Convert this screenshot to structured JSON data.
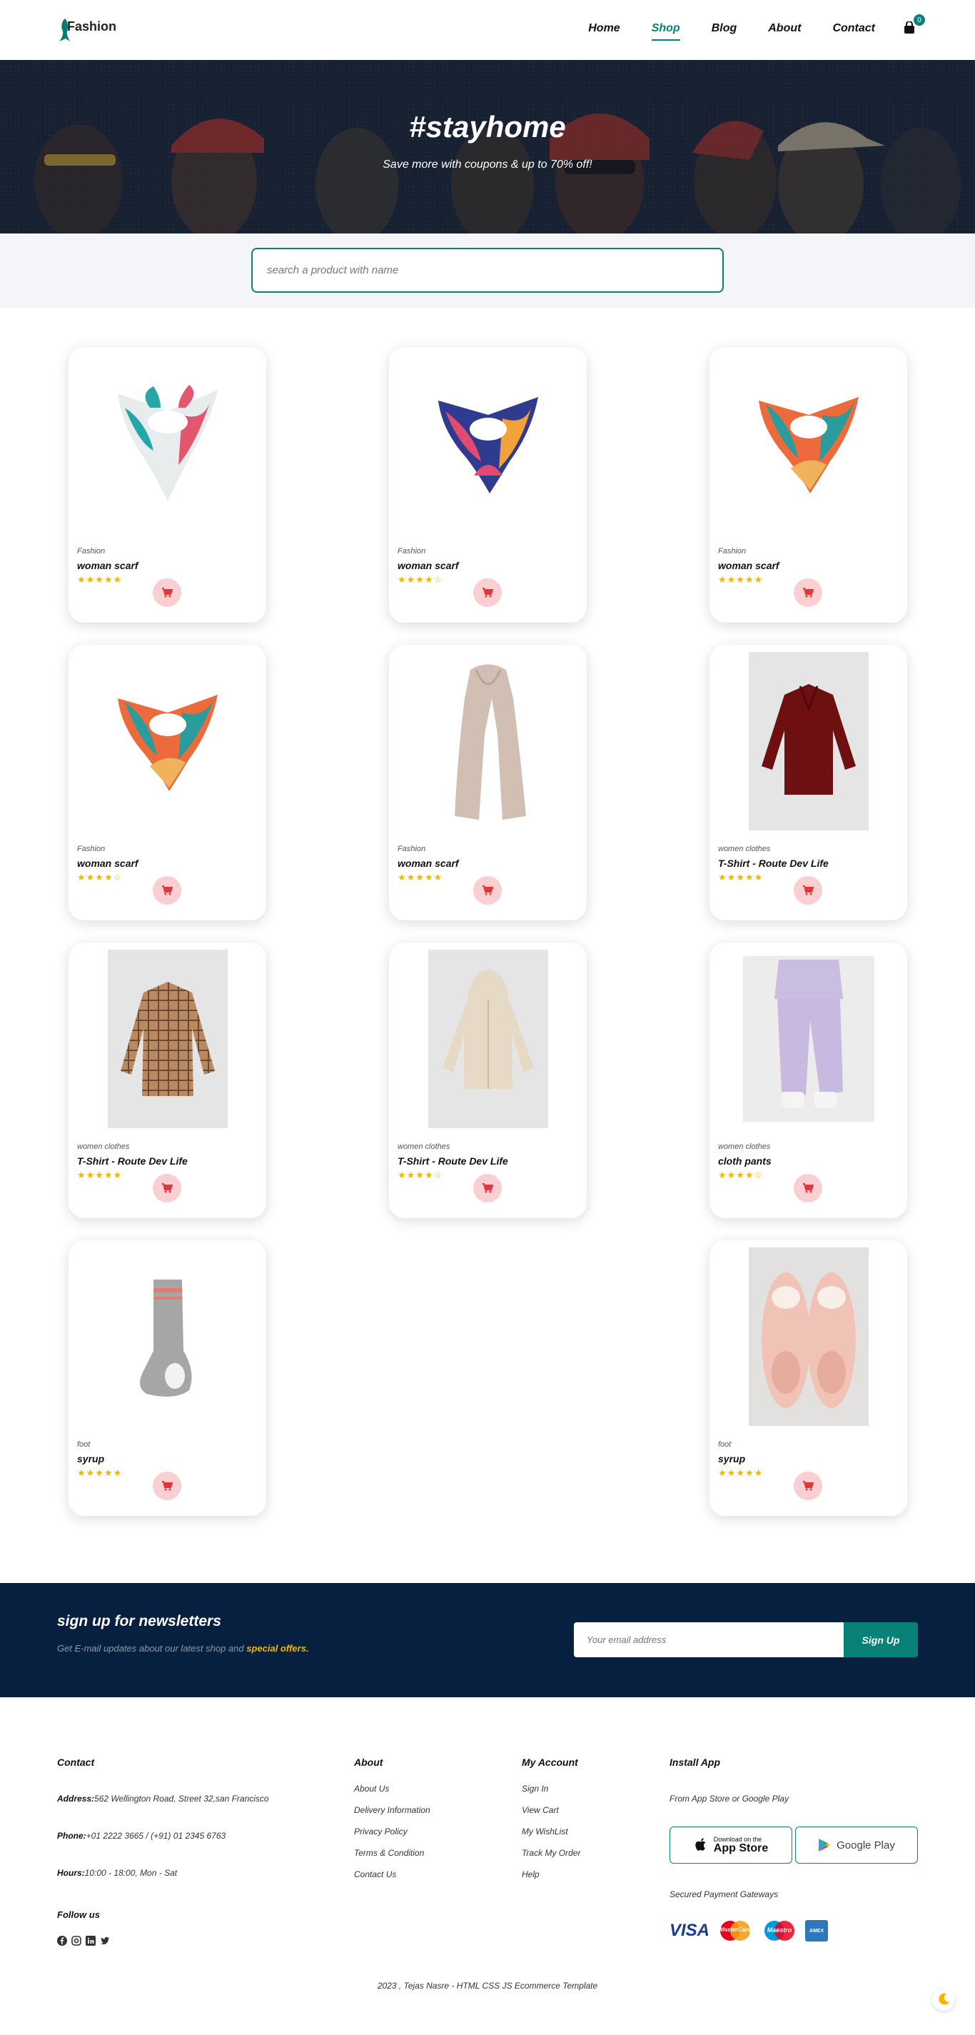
{
  "header": {
    "logo_text": "Fashion",
    "nav": [
      "Home",
      "Shop",
      "Blog",
      "About",
      "Contact"
    ],
    "active_nav": "Shop",
    "cart_count": "0"
  },
  "hero": {
    "title": "#stayhome",
    "subtitle": "Save more with coupons & up to 70% off!"
  },
  "search": {
    "placeholder": "search a product with name"
  },
  "products": [
    {
      "category": "Fashion",
      "name": "woman scarf",
      "stars": "★★★★★",
      "image": "scarf-white-teal"
    },
    {
      "category": "Fashion",
      "name": "woman scarf",
      "stars": "★★★★☆",
      "image": "scarf-blue-pink"
    },
    {
      "category": "Fashion",
      "name": "woman scarf",
      "stars": "★★★★★",
      "image": "scarf-teal-orange"
    },
    {
      "category": "Fashion",
      "name": "woman scarf",
      "stars": "★★★★☆",
      "image": "scarf-teal-orange"
    },
    {
      "category": "Fashion",
      "name": "woman scarf",
      "stars": "★★★★★",
      "image": "scarf-beige-long"
    },
    {
      "category": "women clothes",
      "name": "T-Shirt - Route Dev Life",
      "stars": "★★★★★",
      "image": "shirt-maroon"
    },
    {
      "category": "women clothes",
      "name": "T-Shirt - Route Dev Life",
      "stars": "★★★★★",
      "image": "shirt-plaid-brown"
    },
    {
      "category": "women clothes",
      "name": "T-Shirt - Route Dev Life",
      "stars": "★★★★☆",
      "image": "hoodie-cream"
    },
    {
      "category": "women clothes",
      "name": "cloth pants",
      "stars": "★★★★☆",
      "image": "pants-lilac"
    },
    {
      "category": "foot",
      "name": "syrup",
      "stars": "★★★★★",
      "image": "sock-grey"
    },
    {
      "category": "foot",
      "name": "syrup",
      "stars": "★★★★★",
      "image": "slippers-pink"
    }
  ],
  "newsletter": {
    "title": "sign up for newsletters",
    "text": "Get E-mail updates about our latest shop and",
    "highlight": "special offers.",
    "email_placeholder": "Your email address",
    "button": "Sign Up"
  },
  "footer": {
    "contact_title": "Contact",
    "address_label": "Address:",
    "address": "562 Wellington Road, Street 32,san Francisco",
    "phone_label": "Phone:",
    "phone": "+01 2222 3665 / (+91) 01 2345 6763",
    "hours_label": "Hours:",
    "hours": "10:00 - 18:00, Mon - Sat",
    "follow_title": "Follow us",
    "about_title": "About",
    "about_links": [
      "About Us",
      "Delivery Information",
      "Privacy Policy",
      "Terms & Condition",
      "Contact Us"
    ],
    "account_title": "My Account",
    "account_links": [
      "Sign In",
      "View Cart",
      "My WishList",
      "Track My Order",
      "Help"
    ],
    "install_title": "Install App",
    "install_text": "From App Store or Google Play",
    "appstore_small": "Download on the",
    "appstore_big": "App Store",
    "googleplay": "Google Play",
    "payment_title": "Secured Payment Gateways",
    "payments": [
      "VISA",
      "MasterCard",
      "Maestro",
      "AMEX"
    ],
    "copyright": "2023 , Tejas Nasre - HTML CSS JS Ecommerce Template"
  }
}
